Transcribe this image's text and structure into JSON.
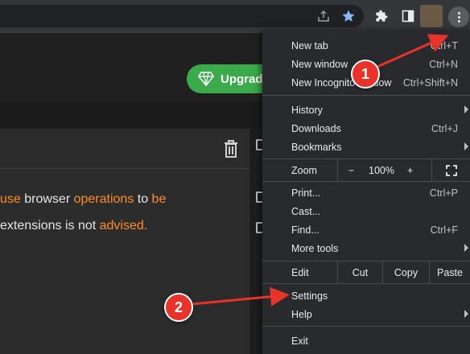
{
  "toolbar": {
    "icons": [
      "share-icon",
      "star-icon",
      "extensions-icon",
      "side-panel-icon",
      "profile-avatar",
      "more-options-icon"
    ],
    "star_color": "#8ab4f8"
  },
  "page": {
    "upgrade_label": "Upgrade",
    "upgrade_color": "#3aaa4a",
    "line1": {
      "part1": "use",
      "part2": " browser ",
      "part3": "operations",
      "part4": " to ",
      "part5": "be"
    },
    "line2": {
      "part1": "extensions is not ",
      "part2": "advised."
    },
    "highlight_color": "#ff8c2a"
  },
  "menu": {
    "new_tab": {
      "label": "New tab",
      "shortcut": "Ctrl+T"
    },
    "new_window": {
      "label": "New window",
      "shortcut": "Ctrl+N"
    },
    "new_incognito": {
      "label": "New Incognito window",
      "shortcut": "Ctrl+Shift+N"
    },
    "history": {
      "label": "History"
    },
    "downloads": {
      "label": "Downloads",
      "shortcut": "Ctrl+J"
    },
    "bookmarks": {
      "label": "Bookmarks"
    },
    "zoom": {
      "label": "Zoom",
      "minus": "−",
      "value": "100%",
      "plus": "+"
    },
    "print": {
      "label": "Print...",
      "shortcut": "Ctrl+P"
    },
    "cast": {
      "label": "Cast..."
    },
    "find": {
      "label": "Find...",
      "shortcut": "Ctrl+F"
    },
    "more_tools": {
      "label": "More tools"
    },
    "edit": {
      "label": "Edit",
      "cut": "Cut",
      "copy": "Copy",
      "paste": "Paste"
    },
    "settings": {
      "label": "Settings"
    },
    "help": {
      "label": "Help"
    },
    "exit": {
      "label": "Exit"
    }
  },
  "annotations": {
    "badge1": "1",
    "badge2": "2",
    "color": "#e8332b"
  }
}
